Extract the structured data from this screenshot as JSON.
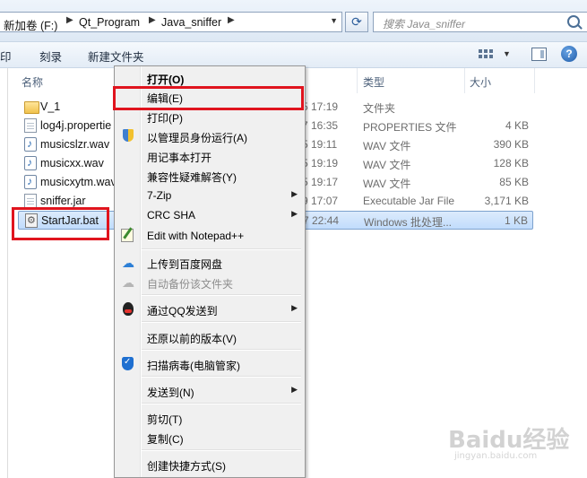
{
  "address": {
    "crumbs": [
      "新加卷 (F:)",
      "Qt_Program",
      "Java_sniffer"
    ],
    "search_placeholder": "搜索 Java_sniffer"
  },
  "toolbar": {
    "items": [
      "印",
      "刻录",
      "新建文件夹"
    ]
  },
  "columns": {
    "name": "名称",
    "type": "类型",
    "size": "大小"
  },
  "files": [
    {
      "name": "V_1",
      "date": "5 17:19",
      "type": "文件夹",
      "size": "",
      "icon": "folder-icon"
    },
    {
      "name": "log4j.propertie",
      "date": "7 16:35",
      "type": "PROPERTIES 文件",
      "size": "4 KB",
      "icon": "file-icon"
    },
    {
      "name": "musicslzr.wav",
      "date": "5 19:11",
      "type": "WAV 文件",
      "size": "390 KB",
      "icon": "wav-icon"
    },
    {
      "name": "musicxx.wav",
      "date": "5 19:19",
      "type": "WAV 文件",
      "size": "128 KB",
      "icon": "wav-icon"
    },
    {
      "name": "musicxytm.wav",
      "date": "5 19:17",
      "type": "WAV 文件",
      "size": "85 KB",
      "icon": "wav-icon"
    },
    {
      "name": "sniffer.jar",
      "date": "9 17:07",
      "type": "Executable Jar File",
      "size": "3,171 KB",
      "icon": "file-icon"
    },
    {
      "name": "StartJar.bat",
      "date": "7 22:44",
      "type": "Windows 批处理...",
      "size": "1 KB",
      "icon": "bat-icon"
    }
  ],
  "menu": {
    "open": "打开(O)",
    "edit": "编辑(E)",
    "print": "打印(P)",
    "run_as_admin": "以管理员身份运行(A)",
    "open_notepad": "用记事本打开",
    "compat": "兼容性疑难解答(Y)",
    "zip": "7-Zip",
    "crc": "CRC SHA",
    "notepadpp": "Edit with Notepad++",
    "baidu_upload": "上传到百度网盘",
    "auto_backup": "自动备份该文件夹",
    "qq_send": "通过QQ发送到",
    "restore": "还原以前的版本(V)",
    "scan": "扫描病毒(电脑管家)",
    "send_to": "发送到(N)",
    "cut": "剪切(T)",
    "copy": "复制(C)",
    "shortcut": "创建快捷方式(S)"
  },
  "watermark": {
    "main": "Baidu经验",
    "sub": "jingyan.baidu.com"
  },
  "colors": {
    "highlight": "#e0141e",
    "selection": "#c1dcfc"
  }
}
